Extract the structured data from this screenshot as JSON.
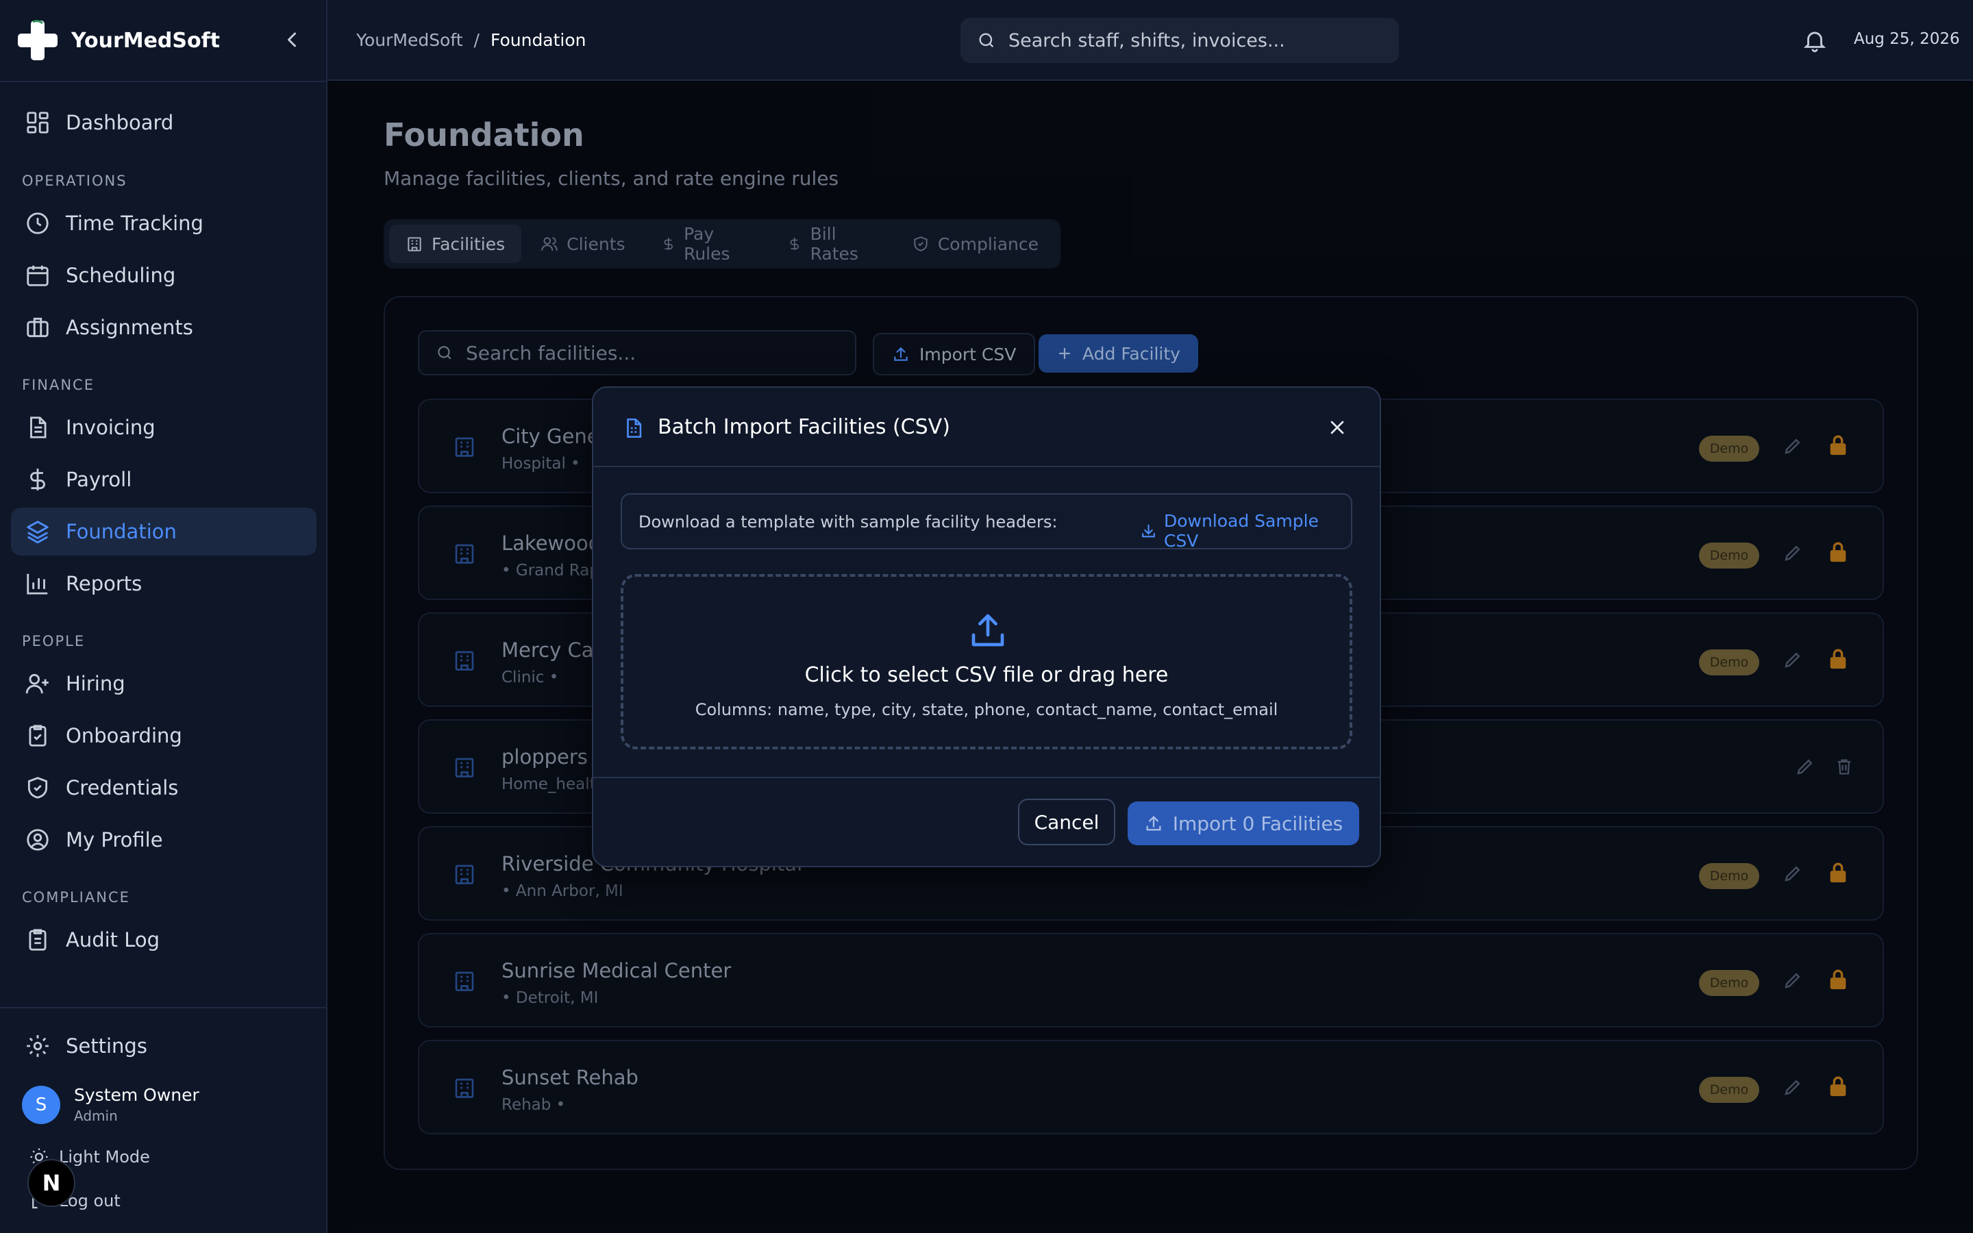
{
  "app": {
    "name": "YourMedSoft"
  },
  "sidebar": {
    "dashboard": "Dashboard",
    "sections": {
      "operations": "OPERATIONS",
      "finance": "FINANCE",
      "people": "PEOPLE",
      "compliance": "COMPLIANCE"
    },
    "items": {
      "time_tracking": "Time Tracking",
      "scheduling": "Scheduling",
      "assignments": "Assignments",
      "invoicing": "Invoicing",
      "payroll": "Payroll",
      "foundation": "Foundation",
      "reports": "Reports",
      "hiring": "Hiring",
      "onboarding": "Onboarding",
      "credentials": "Credentials",
      "my_profile": "My Profile",
      "audit_log": "Audit Log",
      "settings": "Settings"
    },
    "active": "foundation",
    "user": {
      "initial": "S",
      "name": "System Owner",
      "role": "Admin"
    },
    "light_mode": "Light Mode",
    "logout": "Log out",
    "dev_badge": "N"
  },
  "topbar": {
    "breadcrumb_root": "YourMedSoft",
    "breadcrumb_sep": "/",
    "breadcrumb_current": "Foundation",
    "search_placeholder": "Search staff, shifts, invoices...",
    "date": "Aug 25, 2026"
  },
  "page": {
    "title": "Foundation",
    "subtitle": "Manage facilities, clients, and rate engine rules",
    "tabs": [
      "Facilities",
      "Clients",
      "Pay Rules",
      "Bill Rates",
      "Compliance"
    ],
    "active_tab": "Facilities"
  },
  "facilities": {
    "search_placeholder": "Search facilities...",
    "import_label": "Import CSV",
    "add_label": "Add Facility",
    "demo_label": "Demo",
    "rows": [
      {
        "name": "City Gene",
        "meta": "Hospital •",
        "demo": true
      },
      {
        "name": "Lakewood",
        "meta": "• Grand Rap",
        "demo": true
      },
      {
        "name": "Mercy Car",
        "meta": "Clinic •",
        "demo": true
      },
      {
        "name": "ploppers",
        "meta": "Home_healt",
        "demo": false
      },
      {
        "name": "Riverside Community Hospital",
        "meta": "• Ann Arbor, MI",
        "demo": true
      },
      {
        "name": "Sunrise Medical Center",
        "meta": "• Detroit, MI",
        "demo": true
      },
      {
        "name": "Sunset Rehab",
        "meta": "Rehab •",
        "demo": true
      }
    ]
  },
  "modal": {
    "title": "Batch Import Facilities (CSV)",
    "template_text": "Download a template with sample facility headers:",
    "download_label": "Download Sample CSV",
    "drop_title": "Click to select CSV file or drag here",
    "drop_columns": "Columns: name, type, city, state, phone, contact_name, contact_email",
    "cancel_label": "Cancel",
    "import_label": "Import 0 Facilities"
  },
  "colors": {
    "accent": "#4d8dfb",
    "primary_button": "#2b5ab7",
    "demo_badge": "#6b5e36",
    "lock": "#b7761a"
  }
}
